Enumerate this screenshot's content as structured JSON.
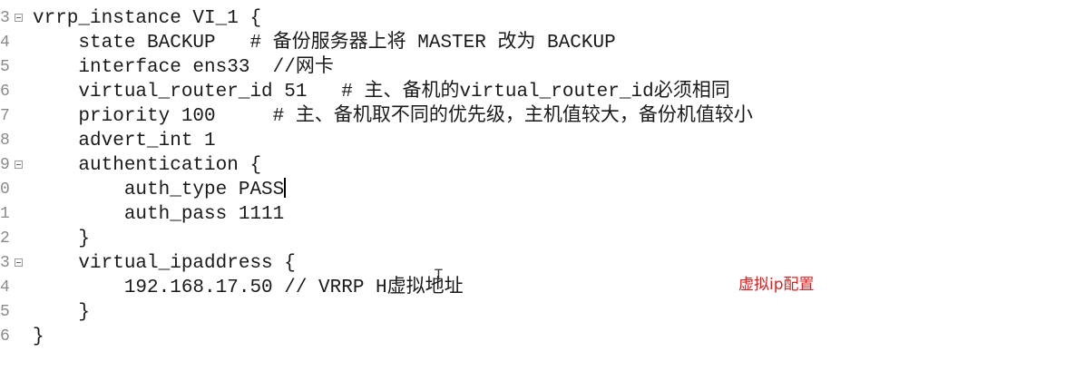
{
  "editor": {
    "lines": [
      {
        "number": "3",
        "text": "vrrp_instance VI_1 {",
        "fold": true
      },
      {
        "number": "4",
        "text": "    state BACKUP   # 备份服务器上将 MASTER 改为 BACKUP",
        "fold": false
      },
      {
        "number": "5",
        "text": "    interface ens33  //网卡",
        "fold": false
      },
      {
        "number": "6",
        "text": "    virtual_router_id 51   # 主、备机的virtual_router_id必须相同",
        "fold": false
      },
      {
        "number": "7",
        "text": "    priority 100     # 主、备机取不同的优先级，主机值较大，备份机值较小",
        "fold": false
      },
      {
        "number": "8",
        "text": "    advert_int 1",
        "fold": false
      },
      {
        "number": "9",
        "text": "    authentication {",
        "fold": true
      },
      {
        "number": "0",
        "text": "        auth_type PASS",
        "fold": false
      },
      {
        "number": "1",
        "text": "        auth_pass 1111",
        "fold": false
      },
      {
        "number": "2",
        "text": "    }",
        "fold": false
      },
      {
        "number": "3",
        "text": "    virtual_ipaddress {",
        "fold": true
      },
      {
        "number": "4",
        "text": "        192.168.17.50 // VRRP H虚拟地址",
        "fold": false
      },
      {
        "number": "5",
        "text": "    }",
        "fold": false
      },
      {
        "number": "6",
        "text": "}",
        "fold": false
      }
    ],
    "cursor_line": 7
  },
  "annotation": {
    "text": "虚拟ip配置",
    "color": "#e02020"
  },
  "icons": {
    "fold_marker": "fold-collapse-icon",
    "mouse_cursor": "text-cursor-icon"
  }
}
